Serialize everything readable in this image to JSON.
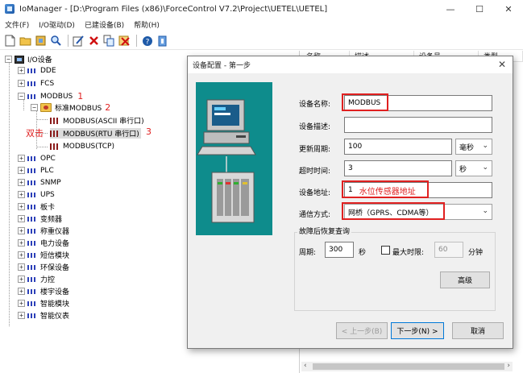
{
  "window": {
    "title": "IoManager - [D:\\Program Files (x86)\\ForceControl V7.2\\Project\\UETEL\\UETEL]",
    "minimize": "—",
    "maximize": "☐",
    "close": "✕"
  },
  "menu": [
    "文件(F)",
    "I/O驱动(D)",
    "已建设备(B)",
    "帮助(H)"
  ],
  "toolbar": [
    "new-icon",
    "open-icon",
    "properties-icon",
    "find-icon",
    "edit-icon",
    "delete-icon",
    "copy-icon",
    "cut-icon",
    "help-icon",
    "exit-icon"
  ],
  "tree": {
    "root": "I/O设备",
    "items": [
      "DDE",
      "FCS",
      "MODBUS",
      "OPC",
      "PLC",
      "SNMP",
      "UPS",
      "板卡",
      "变频器",
      "称重仪器",
      "电力设备",
      "短信模块",
      "环保设备",
      "力控",
      "楼宇设备",
      "智能模块",
      "智能仪表"
    ],
    "modbus_child": "标准MODBUS",
    "channels": [
      "MODBUS(ASCII 串行口)",
      "MODBUS(RTU 串行口)",
      "MODBUS(TCP)"
    ]
  },
  "annotations": {
    "n1": "1",
    "n2": "2",
    "n3": "3",
    "dblclick": "双击"
  },
  "right_columns": [
    "名称",
    "描述",
    "设备号 ·",
    "类型"
  ],
  "dialog": {
    "title": "设备配置 - 第一步",
    "device_name_label": "设备名称:",
    "device_name_value": "MODBUS",
    "device_desc_label": "设备描述:",
    "device_desc_value": "",
    "update_label": "更新周期:",
    "update_value": "100",
    "update_unit": "毫秒",
    "timeout_label": "超时时间:",
    "timeout_value": "3",
    "timeout_unit": "秒",
    "address_label": "设备地址:",
    "address_value": "1",
    "address_note": "水位传感器地址",
    "comm_label": "通信方式:",
    "comm_value": "网桥（GPRS、CDMA等）",
    "recovery_group": "故障后恢复查询",
    "period_label": "周期:",
    "period_value": "300",
    "period_unit": "秒",
    "max_time_label": "最大时限:",
    "max_time_value": "60",
    "max_time_unit": "分钟",
    "advanced_button": "高级",
    "prev_button": "< 上一步(B)",
    "next_button": "下一步(N) >",
    "cancel_button": "取消"
  },
  "colors": {
    "annotation_red": "#e02020",
    "illustration_bg": "#0e8c8c",
    "device_icon": "#2b3fb8"
  }
}
